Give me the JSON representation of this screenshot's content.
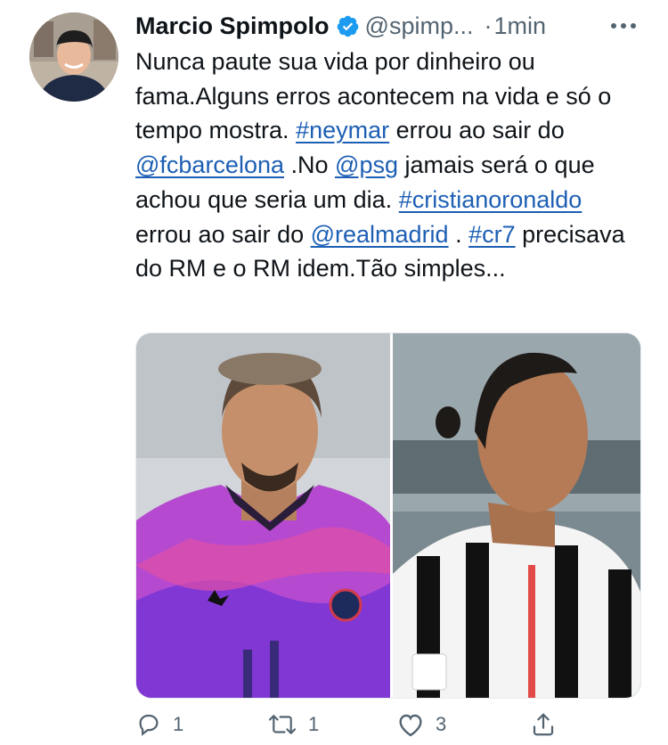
{
  "tweet": {
    "author_name": "Marcio Spimpolo",
    "handle": "@spimp...",
    "separator": "·",
    "time": "1min",
    "text_segments": [
      {
        "text": "Nunca paute sua vida por dinheiro ou fama.Alguns erros acontecem na vida e só o tempo mostra. ",
        "link": false
      },
      {
        "text": "#neymar",
        "link": true
      },
      {
        "text": " errou ao sair do ",
        "link": false
      },
      {
        "text": "@fcbarcelona",
        "link": true
      },
      {
        "text": " .No ",
        "link": false
      },
      {
        "text": "@psg",
        "link": true
      },
      {
        "text": " jamais será o que achou que seria um dia. ",
        "link": false
      },
      {
        "text": "#cristianoronaldo",
        "link": true
      },
      {
        "text": " errou ao sair do ",
        "link": false
      },
      {
        "text": "@realmadrid",
        "link": true
      },
      {
        "text": " . ",
        "link": false
      },
      {
        "text": "#cr7",
        "link": true
      },
      {
        "text": " precisava do RM e o RM idem.Tão simples...",
        "link": false
      }
    ]
  },
  "media": {
    "left_photo": "neymar-photo",
    "right_photo": "cristiano-ronaldo-photo"
  },
  "actions": {
    "reply_count": "1",
    "retweet_count": "1",
    "like_count": "3"
  },
  "colors": {
    "text": "#0f1419",
    "secondary": "#536471",
    "link": "#1d5fb4",
    "verified": "#1d9bf0"
  },
  "icons": [
    "verified-badge-icon",
    "more-icon",
    "reply-icon",
    "retweet-icon",
    "like-icon",
    "share-icon"
  ]
}
